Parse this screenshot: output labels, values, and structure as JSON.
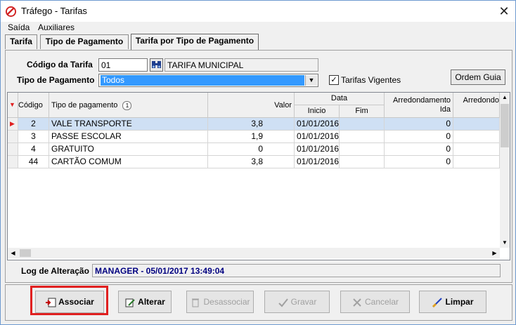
{
  "window": {
    "title": "Tráfego - Tarifas",
    "close_glyph": "✕"
  },
  "menu": {
    "items": [
      "Saída",
      "Auxiliares"
    ]
  },
  "tabs": [
    {
      "label": "Tarifa"
    },
    {
      "label": "Tipo de Pagamento"
    },
    {
      "label": "Tarifa por Tipo de Pagamento"
    }
  ],
  "filters": {
    "codigo_label": "Código da Tarifa",
    "codigo_value": "01",
    "tarifa_name": "TARIFA MUNICIPAL",
    "tipo_label": "Tipo de Pagamento",
    "tipo_value": "Todos",
    "vigentes_label": "Tarifas Vigentes",
    "vigentes_checked": true,
    "ordem_button": "Ordem Guia"
  },
  "grid": {
    "headers": {
      "codigo": "Código",
      "tipo": "Tipo de pagamento",
      "sort_badge": "1",
      "valor": "Valor",
      "data": "Data",
      "inicio": "Inicio",
      "fim": "Fim",
      "arred_ida_1": "Arredondamento",
      "arred_ida_2": "Ida",
      "arred_volta": "Arredondo"
    },
    "rows": [
      {
        "codigo": "2",
        "tipo": "VALE TRANSPORTE",
        "valor": "3,8",
        "inicio": "01/01/2016",
        "fim": "",
        "arred": "0"
      },
      {
        "codigo": "3",
        "tipo": "PASSE ESCOLAR",
        "valor": "1,9",
        "inicio": "01/01/2016",
        "fim": "",
        "arred": "0"
      },
      {
        "codigo": "4",
        "tipo": "GRATUITO",
        "valor": "0",
        "inicio": "01/01/2016",
        "fim": "",
        "arred": "0"
      },
      {
        "codigo": "44",
        "tipo": "CARTÃO COMUM",
        "valor": "3,8",
        "inicio": "01/01/2016",
        "fim": "",
        "arred": "0"
      }
    ]
  },
  "log": {
    "label": "Log de Alteração",
    "value": "MANAGER - 05/01/2017 13:49:04"
  },
  "actions": {
    "associar": "Associar",
    "alterar": "Alterar",
    "desassociar": "Desassociar",
    "gravar": "Gravar",
    "cancelar": "Cancelar",
    "limpar": "Limpar"
  },
  "colors": {
    "selection": "#3399ff",
    "row_selected": "#cfe0f4",
    "highlight_box": "#e02020",
    "log_text": "#000080"
  }
}
